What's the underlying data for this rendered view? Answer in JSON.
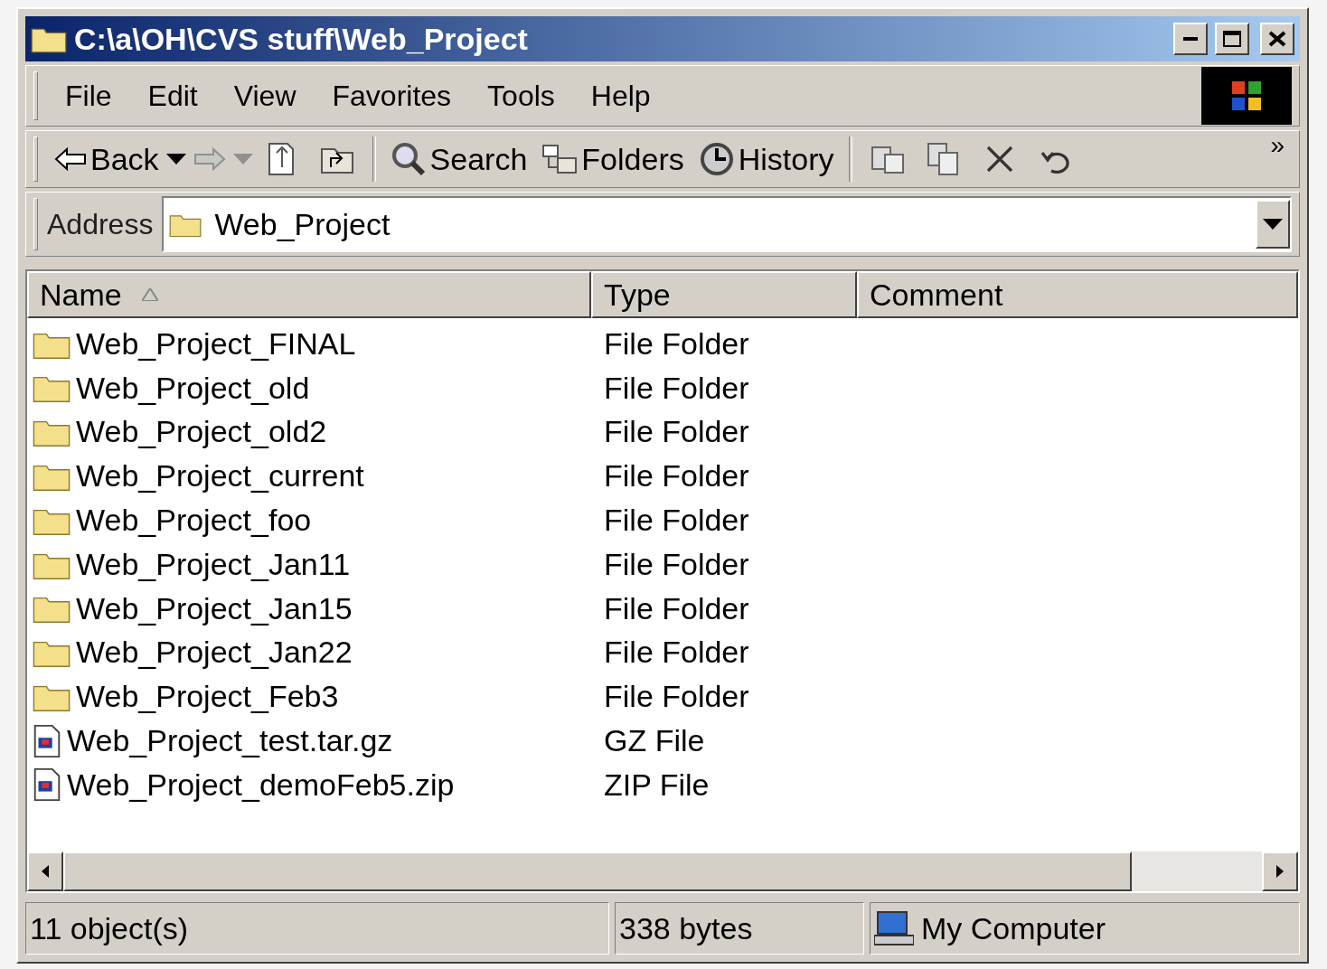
{
  "window": {
    "title": "C:\\a\\OH\\CVS stuff\\Web_Project"
  },
  "menu": [
    "File",
    "Edit",
    "View",
    "Favorites",
    "Tools",
    "Help"
  ],
  "toolbar": {
    "back": {
      "label": "Back"
    },
    "forward": {
      "disabled": true
    },
    "search": {
      "label": "Search"
    },
    "folders": {
      "label": "Folders"
    },
    "history": {
      "label": "History"
    },
    "overflow": "»"
  },
  "address": {
    "label": "Address",
    "value": "Web_Project"
  },
  "table": {
    "columns": [
      {
        "label": "Name",
        "sorted": true
      },
      {
        "label": "Type",
        "sorted": false
      },
      {
        "label": "Comment",
        "sorted": false
      }
    ],
    "rows": [
      {
        "kind": "folder",
        "name": "Web_Project_FINAL",
        "type": "File Folder"
      },
      {
        "kind": "folder",
        "name": "Web_Project_old",
        "type": "File Folder"
      },
      {
        "kind": "folder",
        "name": "Web_Project_old2",
        "type": "File Folder"
      },
      {
        "kind": "folder",
        "name": "Web_Project_current",
        "type": "File Folder"
      },
      {
        "kind": "folder",
        "name": "Web_Project_foo",
        "type": "File Folder"
      },
      {
        "kind": "folder",
        "name": "Web_Project_Jan11",
        "type": "File Folder"
      },
      {
        "kind": "folder",
        "name": "Web_Project_Jan15",
        "type": "File Folder"
      },
      {
        "kind": "folder",
        "name": "Web_Project_Jan22",
        "type": "File Folder"
      },
      {
        "kind": "folder",
        "name": "Web_Project_Feb3",
        "type": "File Folder"
      },
      {
        "kind": "archive",
        "name": "Web_Project_test.tar.gz",
        "type": "GZ File"
      },
      {
        "kind": "archive",
        "name": "Web_Project_demoFeb5.zip",
        "type": "ZIP File"
      }
    ]
  },
  "status_bar": {
    "count": "11 object(s)",
    "size": "338 bytes",
    "zone": "My Computer"
  }
}
